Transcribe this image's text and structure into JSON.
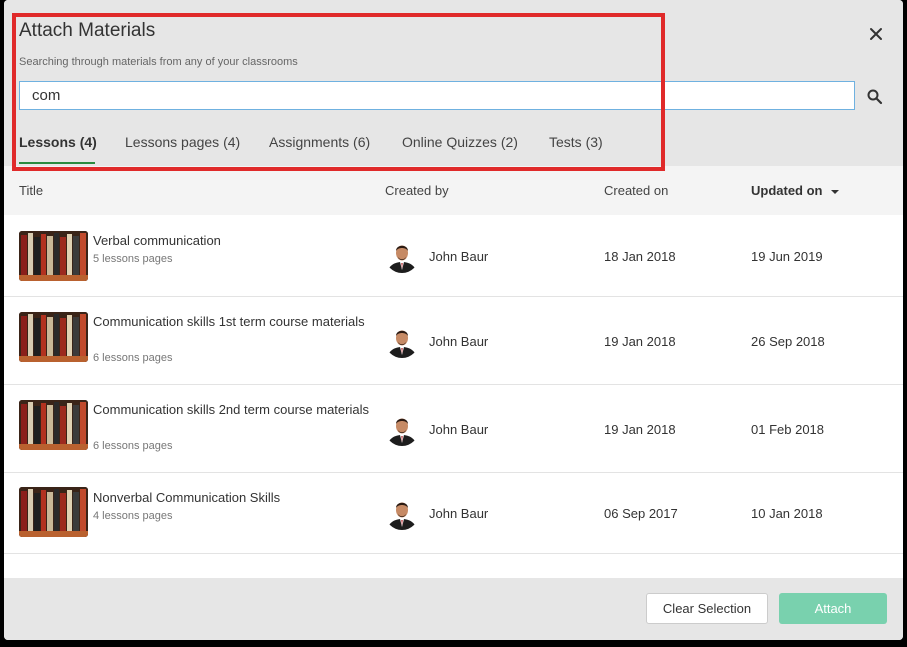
{
  "modal": {
    "title": "Attach Materials",
    "subtitle": "Searching through materials from any of your classrooms",
    "close_icon": "close-icon"
  },
  "search": {
    "value": "com",
    "icon": "search-icon"
  },
  "tabs": [
    {
      "label": "Lessons (4)",
      "active": true
    },
    {
      "label": "Lessons pages (4)",
      "active": false
    },
    {
      "label": "Assignments (6)",
      "active": false
    },
    {
      "label": "Online Quizzes (2)",
      "active": false
    },
    {
      "label": "Tests (3)",
      "active": false
    }
  ],
  "table": {
    "headers": {
      "title": "Title",
      "created_by": "Created by",
      "created_on": "Created on",
      "updated_on": "Updated on"
    },
    "sort_icon": "caret-down-icon",
    "rows": [
      {
        "title": "Verbal communication",
        "subtitle": "5 lessons pages",
        "author": "John Baur",
        "created_on": "18 Jan 2018",
        "updated_on": "19 Jun 2019"
      },
      {
        "title": "Communication skills 1st term course materials",
        "subtitle": "6 lessons pages",
        "author": "John Baur",
        "created_on": "19 Jan 2018",
        "updated_on": "26 Sep 2018"
      },
      {
        "title": "Communication skills 2nd term course materials",
        "subtitle": "6 lessons pages",
        "author": "John Baur",
        "created_on": "19 Jan 2018",
        "updated_on": "01 Feb 2018"
      },
      {
        "title": "Nonverbal Communication Skills",
        "subtitle": "4 lessons pages",
        "author": "John Baur",
        "created_on": "06 Sep 2017",
        "updated_on": "10 Jan 2018"
      }
    ]
  },
  "footer": {
    "clear_label": "Clear Selection",
    "attach_label": "Attach"
  },
  "colors": {
    "accent_green": "#2a8a3e",
    "attach_button": "#79d1ae",
    "highlight": "#e02a2a",
    "search_border": "#6fb1e0"
  }
}
